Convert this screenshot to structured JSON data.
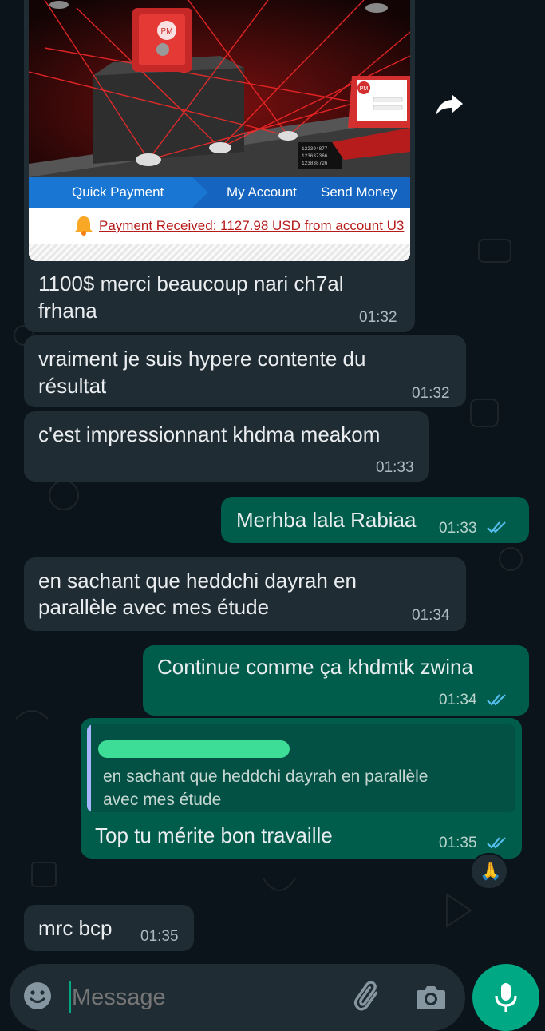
{
  "shared_image": {
    "nav": [
      "Quick Payment",
      "My Account",
      "Send Money"
    ],
    "notice": "Payment Received: 1127.98 USD from account U3",
    "brand_badge": "PM",
    "terminal_lines": [
      "122394877",
      "123637366",
      "123838726"
    ]
  },
  "messages": [
    {
      "dir": "in",
      "text_lines": [
        "1100$ merci beaucoup nari ch7al",
        "frhana"
      ],
      "time": "01:32"
    },
    {
      "dir": "in",
      "text_lines": [
        "vraiment je suis hypere contente du",
        "résultat"
      ],
      "time": "01:32"
    },
    {
      "dir": "in",
      "text_lines": [
        "c'est impressionnant khdma meakom"
      ],
      "time": "01:33"
    },
    {
      "dir": "out",
      "text_lines": [
        "Merhba lala Rabiaa"
      ],
      "time": "01:33"
    },
    {
      "dir": "in",
      "text_lines": [
        "en sachant que heddchi dayrah en",
        "parallèle avec mes étude"
      ],
      "time": "01:34"
    },
    {
      "dir": "out",
      "text_lines": [
        "Continue comme ça khdmtk zwina"
      ],
      "time": "01:34"
    },
    {
      "dir": "out",
      "quote_lines": [
        "en sachant que heddchi dayrah en parallèle",
        "avec mes étude"
      ],
      "text_lines": [
        "Top tu mérite bon travaille"
      ],
      "time": "01:35",
      "reaction": "🙏"
    },
    {
      "dir": "in",
      "text_lines": [
        "mrc bcp"
      ],
      "time": "01:35"
    }
  ],
  "composer": {
    "placeholder": "Message"
  },
  "colors": {
    "incoming": "#202c33",
    "outgoing": "#005c4b",
    "accent": "#00a884",
    "read_ticks": "#53bdeb"
  },
  "icons": [
    "forward-icon",
    "emoji-icon",
    "attach-icon",
    "camera-icon",
    "mic-icon",
    "read-ticks-icon"
  ]
}
